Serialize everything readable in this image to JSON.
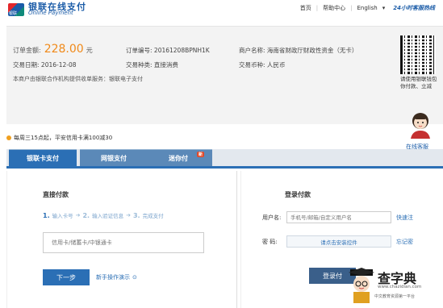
{
  "header": {
    "logo_badge": "银联",
    "logo_cn": "银联在线支付",
    "logo_en": "Online Payment",
    "nav": [
      "首页",
      "帮助中心",
      "English",
      "24小时客服热线"
    ]
  },
  "order": {
    "amount_label": "订单金额:",
    "amount": "228.00",
    "amount_unit": "元",
    "order_no_label": "订单编号:",
    "order_no": "20161208BPNH1K",
    "merchant_label": "商户名称:",
    "merchant": "海南省财政厅财政性资金（无卡）",
    "date_label": "交易日期:",
    "date": "2016-12-08",
    "type_label": "交易种类:",
    "type": "直接消费",
    "currency_label": "交易币种:",
    "currency": "人民币",
    "service_line": "本商户由银联合作机构提供收单服务：银联电子支付"
  },
  "qr": {
    "caption": "请使用银联钱包 你付款、立减"
  },
  "promo": {
    "text": "每周三15点起，平安信用卡满100减30"
  },
  "assistant": {
    "label": "在线客服"
  },
  "tabs": [
    {
      "label": "银联卡支付",
      "active": true
    },
    {
      "label": "网银支付",
      "active": false
    },
    {
      "label": "迷你付",
      "active": false,
      "badge": "新"
    }
  ],
  "direct_pay": {
    "title": "直接付款",
    "steps": [
      {
        "num": "1.",
        "label": "输入卡号"
      },
      {
        "num": "2.",
        "label": "输入验证信息"
      },
      {
        "num": "3.",
        "label": "完成支付"
      }
    ],
    "card_placeholder": "信用卡/储蓄卡/中银通卡",
    "next_label": "下一步",
    "guide_label": "新手操作演示"
  },
  "login_pay": {
    "title": "登录付款",
    "username_label": "用户名:",
    "username_placeholder": "手机号/邮箱/自定义用户名",
    "register_link": "快速注",
    "password_label": "密  码:",
    "install_label": "请点击安装控件",
    "forgot_link": "忘记密",
    "login_label": "登录付"
  },
  "watermark": {
    "title": "查字典",
    "url": "www.chazidian.com",
    "sub": "中文教育资源第一平台"
  },
  "colors": {
    "accent": "#2b6fb5",
    "amount": "#f08a1a"
  }
}
